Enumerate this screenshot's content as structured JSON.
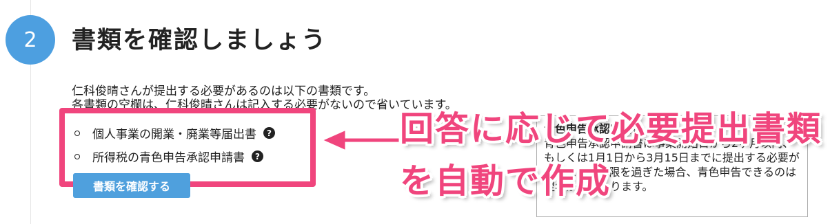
{
  "step": {
    "number": "2",
    "title": "書類を確認しましょう"
  },
  "description": {
    "line1": "仁科俊晴さんが提出する必要があるのは以下の書類です。",
    "line2": "各書類の空欄は、仁科俊晴さんは記入する必要がないので省いています。"
  },
  "documents": [
    {
      "label": "個人事業の開業・廃業等届出書",
      "help_icon": "question-circle"
    },
    {
      "label": "所得税の青色申告承認申請書",
      "help_icon": "question-circle"
    }
  ],
  "confirm_button": {
    "label": "書類を確認する"
  },
  "tooltip": {
    "title": "青色申告承認申請書",
    "body": "青色申告承認申請書は事業開始日から2ヶ月以内、もしくは1月1日から3月15日までに提出する必要があります。期限を過ぎた場合、青色申告できるのは翌年からになります。"
  },
  "annotation": {
    "line1": "回答に応じて必要提出書類",
    "line2": "を自動で作成"
  },
  "colors": {
    "accent_blue": "#4d9fe0",
    "annotation_pink": "#f0457d"
  }
}
